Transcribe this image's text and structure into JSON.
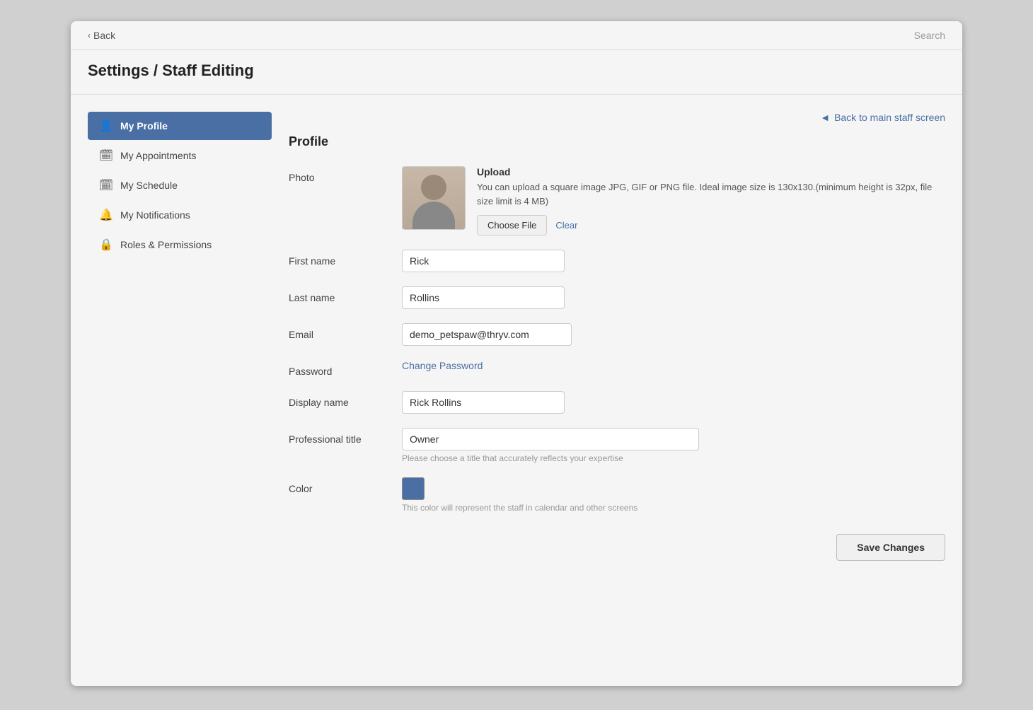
{
  "topbar": {
    "back_label": "Back",
    "search_label": "Search"
  },
  "page": {
    "title": "Settings / Staff Editing"
  },
  "back_staff": {
    "label": "Back to main staff screen"
  },
  "sidebar": {
    "items": [
      {
        "id": "my-profile",
        "label": "My Profile",
        "icon": "👤",
        "active": true
      },
      {
        "id": "my-appointments",
        "label": "My Appointments",
        "icon": "📅",
        "active": false
      },
      {
        "id": "my-schedule",
        "label": "My Schedule",
        "icon": "📅",
        "active": false
      },
      {
        "id": "my-notifications",
        "label": "My Notifications",
        "icon": "🔔",
        "active": false
      },
      {
        "id": "roles-permissions",
        "label": "Roles & Permissions",
        "icon": "🔒",
        "active": false
      }
    ]
  },
  "profile": {
    "section_title": "Profile",
    "photo_label": "Photo",
    "upload_label": "Upload",
    "upload_desc": "You can upload a square image JPG, GIF or PNG file. Ideal image size is 130x130.(minimum height is 32px, file size limit is 4 MB)",
    "choose_file_label": "Choose File",
    "clear_label": "Clear",
    "first_name_label": "First name",
    "first_name_value": "Rick",
    "last_name_label": "Last name",
    "last_name_value": "Rollins",
    "email_label": "Email",
    "email_value": "demo_petspaw@thryv.com",
    "password_label": "Password",
    "change_password_label": "Change Password",
    "display_name_label": "Display name",
    "display_name_value": "Rick Rollins",
    "professional_title_label": "Professional title",
    "professional_title_value": "Owner",
    "professional_title_hint": "Please choose a title that accurately reflects your expertise",
    "color_label": "Color",
    "color_value": "#4a6fa5",
    "color_hint": "This color will represent the staff in calendar and other screens",
    "save_label": "Save Changes"
  }
}
